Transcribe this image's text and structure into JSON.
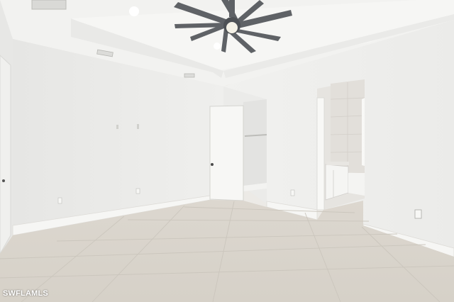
{
  "photo": {
    "scene": "empty-bedroom-interior",
    "watermark": "SWFLAMLS"
  },
  "colors": {
    "wall": "#eeeeec",
    "ceiling": "#f3f3f1",
    "floor_tile": "#dcd8d1",
    "grout": "#cfcac2",
    "fan_blade": "#5f6266",
    "door": "#f7f7f5",
    "bath_tile": "#e6e4e0"
  }
}
